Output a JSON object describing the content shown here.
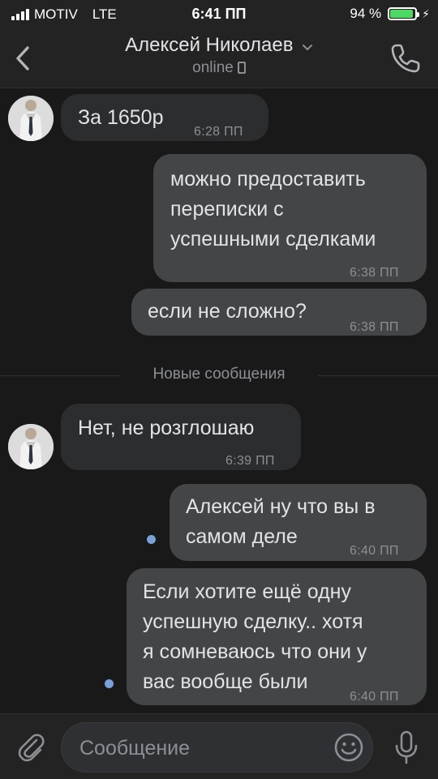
{
  "status_bar": {
    "carrier": "MOTIV",
    "network": "LTE",
    "time": "6:41 ПП",
    "battery": "94 %",
    "battery_level": 0.94
  },
  "header": {
    "title": "Алексей Николаев",
    "subtitle": "online",
    "back_icon": "chevron-left-icon",
    "call_icon": "phone-icon"
  },
  "messages": [
    {
      "direction": "in",
      "text": "За 1650р",
      "time": "6:28 ПП"
    },
    {
      "direction": "out",
      "text": "можно предоставить\nпереписки с\nуспешными сделками",
      "time": "6:38 ПП"
    },
    {
      "direction": "out",
      "text": "если не сложно?",
      "time": "6:38 ПП"
    },
    {
      "direction": "in",
      "text": "Нет, не розглошаю",
      "time": "6:39 ПП"
    },
    {
      "direction": "out",
      "text": "Алексей ну что вы в\nсамом деле",
      "time": "6:40 ПП",
      "unread": true
    },
    {
      "direction": "out",
      "text": "Если хотите ещё одну\nуспешную сделку.. хотя\nя сомневаюсь что они у\nвас вообще были",
      "time": "6:40 ПП",
      "unread": true
    }
  ],
  "divider": {
    "label": "Новые сообщения"
  },
  "composer": {
    "placeholder": "Сообщение",
    "value": ""
  },
  "colors": {
    "background": "#19191a",
    "bar": "#232324",
    "incoming_bubble": "#2c2d2e",
    "outgoing_bubble": "#444546",
    "unread_dot": "#7aa0d8",
    "battery": "#4cd964"
  }
}
